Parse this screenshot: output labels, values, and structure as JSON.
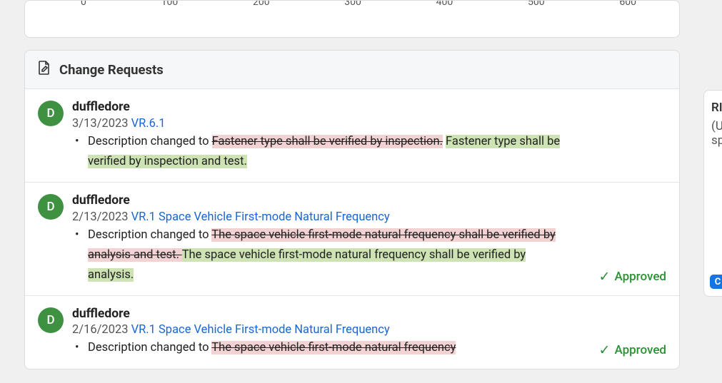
{
  "chart_data": {
    "type": "bar",
    "categories": [
      "0",
      "100",
      "200",
      "300",
      "400",
      "500",
      "600"
    ],
    "values": [],
    "xlabel": "",
    "ylabel": "",
    "xlim": [
      0,
      600
    ]
  },
  "header": {
    "title": "Change Requests"
  },
  "status_label": "Approved",
  "right_panel": {
    "line1": "RI",
    "line2": "(U",
    "line3": "sp",
    "badge": "C"
  },
  "items": [
    {
      "avatar_initial": "D",
      "user": "duffledore",
      "date": "3/13/2023",
      "link": "VR.6.1",
      "prefix": "Description changed to ",
      "removed": "Fastener type shall be verified by inspection.",
      "added": "Fastener type shall be verified by inspection and test.",
      "approved": false
    },
    {
      "avatar_initial": "D",
      "user": "duffledore",
      "date": "2/13/2023",
      "link": "VR.1 Space Vehicle First-mode Natural Frequency",
      "prefix": "Description changed to ",
      "removed": "The space vehicle first-mode natural frequency shall be verified by analysis and test. ",
      "added": "The space vehicle first-mode natural frequency shall be verified by analysis.",
      "approved": true
    },
    {
      "avatar_initial": "D",
      "user": "duffledore",
      "date": "2/16/2023",
      "link": "VR.1 Space Vehicle First-mode Natural Frequency",
      "prefix": "Description changed to ",
      "removed": "The space vehicle first-mode natural frequency",
      "added": "",
      "approved": true
    }
  ]
}
